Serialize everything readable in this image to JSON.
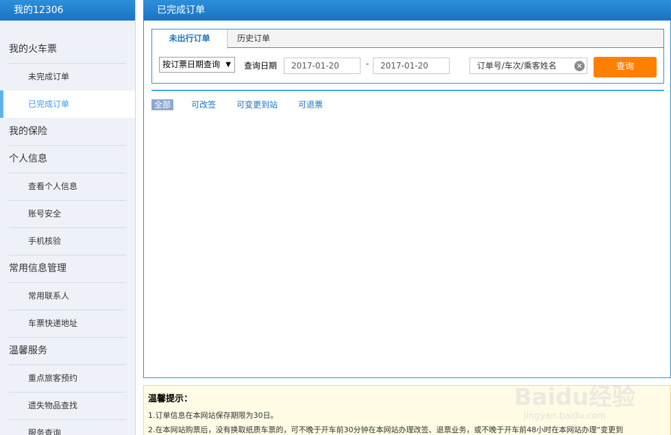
{
  "sidebar": {
    "title": "我的12306",
    "sections": [
      {
        "label": "我的火车票",
        "items": [
          "未完成订单",
          "已完成订单"
        ]
      },
      {
        "label": "我的保险",
        "items": []
      },
      {
        "label": "个人信息",
        "items": [
          "查看个人信息",
          "账号安全",
          "手机核验"
        ]
      },
      {
        "label": "常用信息管理",
        "items": [
          "常用联系人",
          "车票快递地址"
        ]
      },
      {
        "label": "温馨服务",
        "items": [
          "重点旅客预约",
          "遗失物品查找",
          "服务查询"
        ]
      }
    ],
    "active_item": "已完成订单"
  },
  "main": {
    "title": "已完成订单",
    "tabs": [
      "未出行订单",
      "历史订单"
    ],
    "query": {
      "select_value": "按订票日期查询",
      "date_label": "查询日期",
      "date_from": "2017-01-20",
      "date_separator": "-",
      "date_to": "2017-01-20",
      "search_placeholder": "订单号/车次/乘客姓名",
      "query_button": "查询"
    },
    "filters": [
      "全部",
      "可改签",
      "可变更到站",
      "可退票"
    ]
  },
  "tips": {
    "title": "温馨提示：",
    "lines": [
      "1.订单信息在本网站保存期限为30日。",
      "2.在本网站购票后，没有换取纸质车票的，可不晚于开车前30分钟在本网站办理改签、退票业务，或不晚于开车前48小时在本网站办理“变更到"
    ]
  },
  "watermark": {
    "logo": "Baidu经验",
    "url": "jingyan.baidu.com"
  }
}
